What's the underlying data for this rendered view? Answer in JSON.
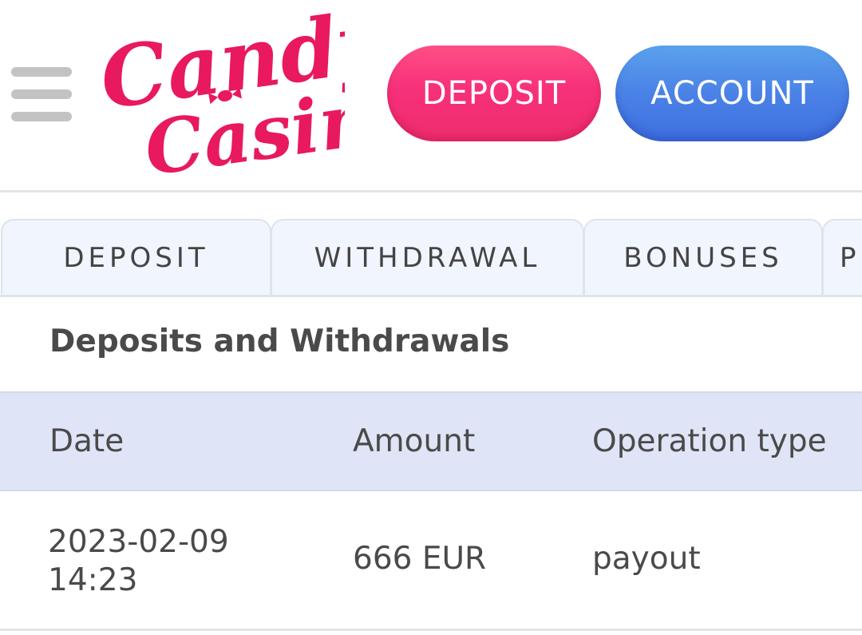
{
  "header": {
    "logo_text_line1": "Candy",
    "logo_text_line2": "Casino",
    "deposit_label": "DEPOSIT",
    "account_label": "ACCOUNT"
  },
  "tabs": [
    {
      "label": "DEPOSIT"
    },
    {
      "label": "WITHDRAWAL"
    },
    {
      "label": "BONUSES"
    },
    {
      "label": "P"
    }
  ],
  "section": {
    "title": "Deposits and Withdrawals"
  },
  "table": {
    "columns": [
      "Date",
      "Amount",
      "Operation type"
    ],
    "rows": [
      {
        "date": "2023-02-09",
        "time": "14:23",
        "amount": "666 EUR",
        "type": "payout"
      }
    ]
  },
  "colors": {
    "brand": "#e8195f",
    "deposit_button": "#f7307a",
    "account_button": "#4a82e6",
    "table_header_bg": "#dfe5f6",
    "tab_bg": "#f1f5fd"
  }
}
